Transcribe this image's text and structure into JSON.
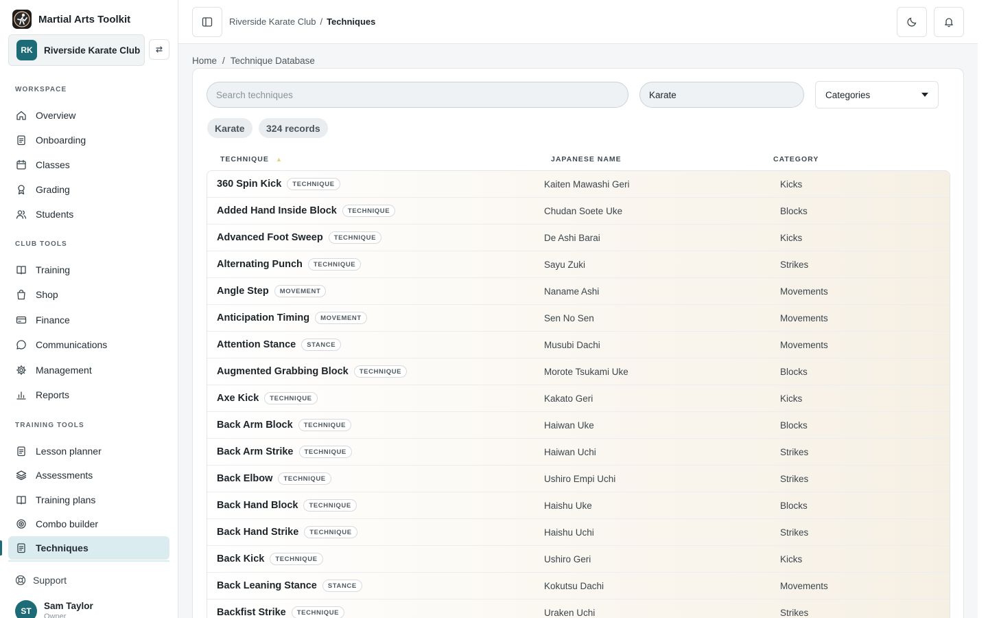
{
  "app": {
    "title": "Martial Arts Toolkit"
  },
  "club": {
    "initials": "RK",
    "name": "Riverside Karate Club"
  },
  "sidebar": {
    "workspace_label": "WORKSPACE",
    "workspace": [
      {
        "label": "Overview",
        "icon": "home-icon"
      },
      {
        "label": "Onboarding",
        "icon": "clipboard-icon"
      },
      {
        "label": "Classes",
        "icon": "calendar-icon"
      },
      {
        "label": "Grading",
        "icon": "award-icon"
      },
      {
        "label": "Students",
        "icon": "users-icon"
      }
    ],
    "club_tools_label": "CLUB TOOLS",
    "club_tools": [
      {
        "label": "Training",
        "icon": "book-icon"
      },
      {
        "label": "Shop",
        "icon": "shopping-bag-icon"
      },
      {
        "label": "Finance",
        "icon": "credit-card-icon"
      },
      {
        "label": "Communications",
        "icon": "message-icon"
      },
      {
        "label": "Management",
        "icon": "gear-icon"
      },
      {
        "label": "Reports",
        "icon": "bar-chart-icon"
      }
    ],
    "training_tools_label": "TRAINING TOOLS",
    "training_tools": [
      {
        "label": "Lesson planner",
        "icon": "clipboard-icon"
      },
      {
        "label": "Assessments",
        "icon": "layers-icon"
      },
      {
        "label": "Training plans",
        "icon": "book-icon"
      },
      {
        "label": "Combo builder",
        "icon": "target-icon"
      },
      {
        "label": "Techniques",
        "icon": "clipboard-icon",
        "active": true
      }
    ],
    "support": "Support",
    "user": {
      "initials": "ST",
      "name": "Sam Taylor",
      "role": "Owner"
    }
  },
  "topbar": {
    "breadcrumb": [
      "Riverside Karate Club",
      "Techniques"
    ],
    "separator": "/"
  },
  "page": {
    "breadcrumb": [
      "Home",
      "Technique Database"
    ],
    "separator": "/",
    "search": {
      "placeholder": "Search techniques",
      "value": ""
    },
    "style_filter": {
      "value": "Karate"
    },
    "category_select": {
      "value": "Categories"
    },
    "chips": [
      "Karate",
      "324 records"
    ],
    "columns": [
      "TECHNIQUE",
      "JAPANESE NAME",
      "CATEGORY"
    ],
    "rows": [
      {
        "name": "360 Spin Kick",
        "type": "TECHNIQUE",
        "japanese": "Kaiten Mawashi Geri",
        "category": "Kicks"
      },
      {
        "name": "Added Hand Inside Block",
        "type": "TECHNIQUE",
        "japanese": "Chudan Soete Uke",
        "category": "Blocks"
      },
      {
        "name": "Advanced Foot Sweep",
        "type": "TECHNIQUE",
        "japanese": "De Ashi Barai",
        "category": "Kicks"
      },
      {
        "name": "Alternating Punch",
        "type": "TECHNIQUE",
        "japanese": "Sayu Zuki",
        "category": "Strikes"
      },
      {
        "name": "Angle Step",
        "type": "MOVEMENT",
        "japanese": "Naname Ashi",
        "category": "Movements"
      },
      {
        "name": "Anticipation Timing",
        "type": "MOVEMENT",
        "japanese": "Sen No Sen",
        "category": "Movements"
      },
      {
        "name": "Attention Stance",
        "type": "STANCE",
        "japanese": "Musubi Dachi",
        "category": "Movements"
      },
      {
        "name": "Augmented Grabbing Block",
        "type": "TECHNIQUE",
        "japanese": "Morote Tsukami Uke",
        "category": "Blocks"
      },
      {
        "name": "Axe Kick",
        "type": "TECHNIQUE",
        "japanese": "Kakato Geri",
        "category": "Kicks"
      },
      {
        "name": "Back Arm Block",
        "type": "TECHNIQUE",
        "japanese": "Haiwan Uke",
        "category": "Blocks"
      },
      {
        "name": "Back Arm Strike",
        "type": "TECHNIQUE",
        "japanese": "Haiwan Uchi",
        "category": "Strikes"
      },
      {
        "name": "Back Elbow",
        "type": "TECHNIQUE",
        "japanese": "Ushiro Empi Uchi",
        "category": "Strikes"
      },
      {
        "name": "Back Hand Block",
        "type": "TECHNIQUE",
        "japanese": "Haishu Uke",
        "category": "Blocks"
      },
      {
        "name": "Back Hand Strike",
        "type": "TECHNIQUE",
        "japanese": "Haishu Uchi",
        "category": "Strikes"
      },
      {
        "name": "Back Kick",
        "type": "TECHNIQUE",
        "japanese": "Ushiro Geri",
        "category": "Kicks"
      },
      {
        "name": "Back Leaning Stance",
        "type": "STANCE",
        "japanese": "Kokutsu Dachi",
        "category": "Movements"
      },
      {
        "name": "Backfist Strike",
        "type": "TECHNIQUE",
        "japanese": "Uraken Uchi",
        "category": "Strikes"
      }
    ]
  },
  "colors": {
    "accent": "#1d6b77",
    "active_bg": "#dbecf0",
    "sort_caret": "#e8cf86"
  }
}
